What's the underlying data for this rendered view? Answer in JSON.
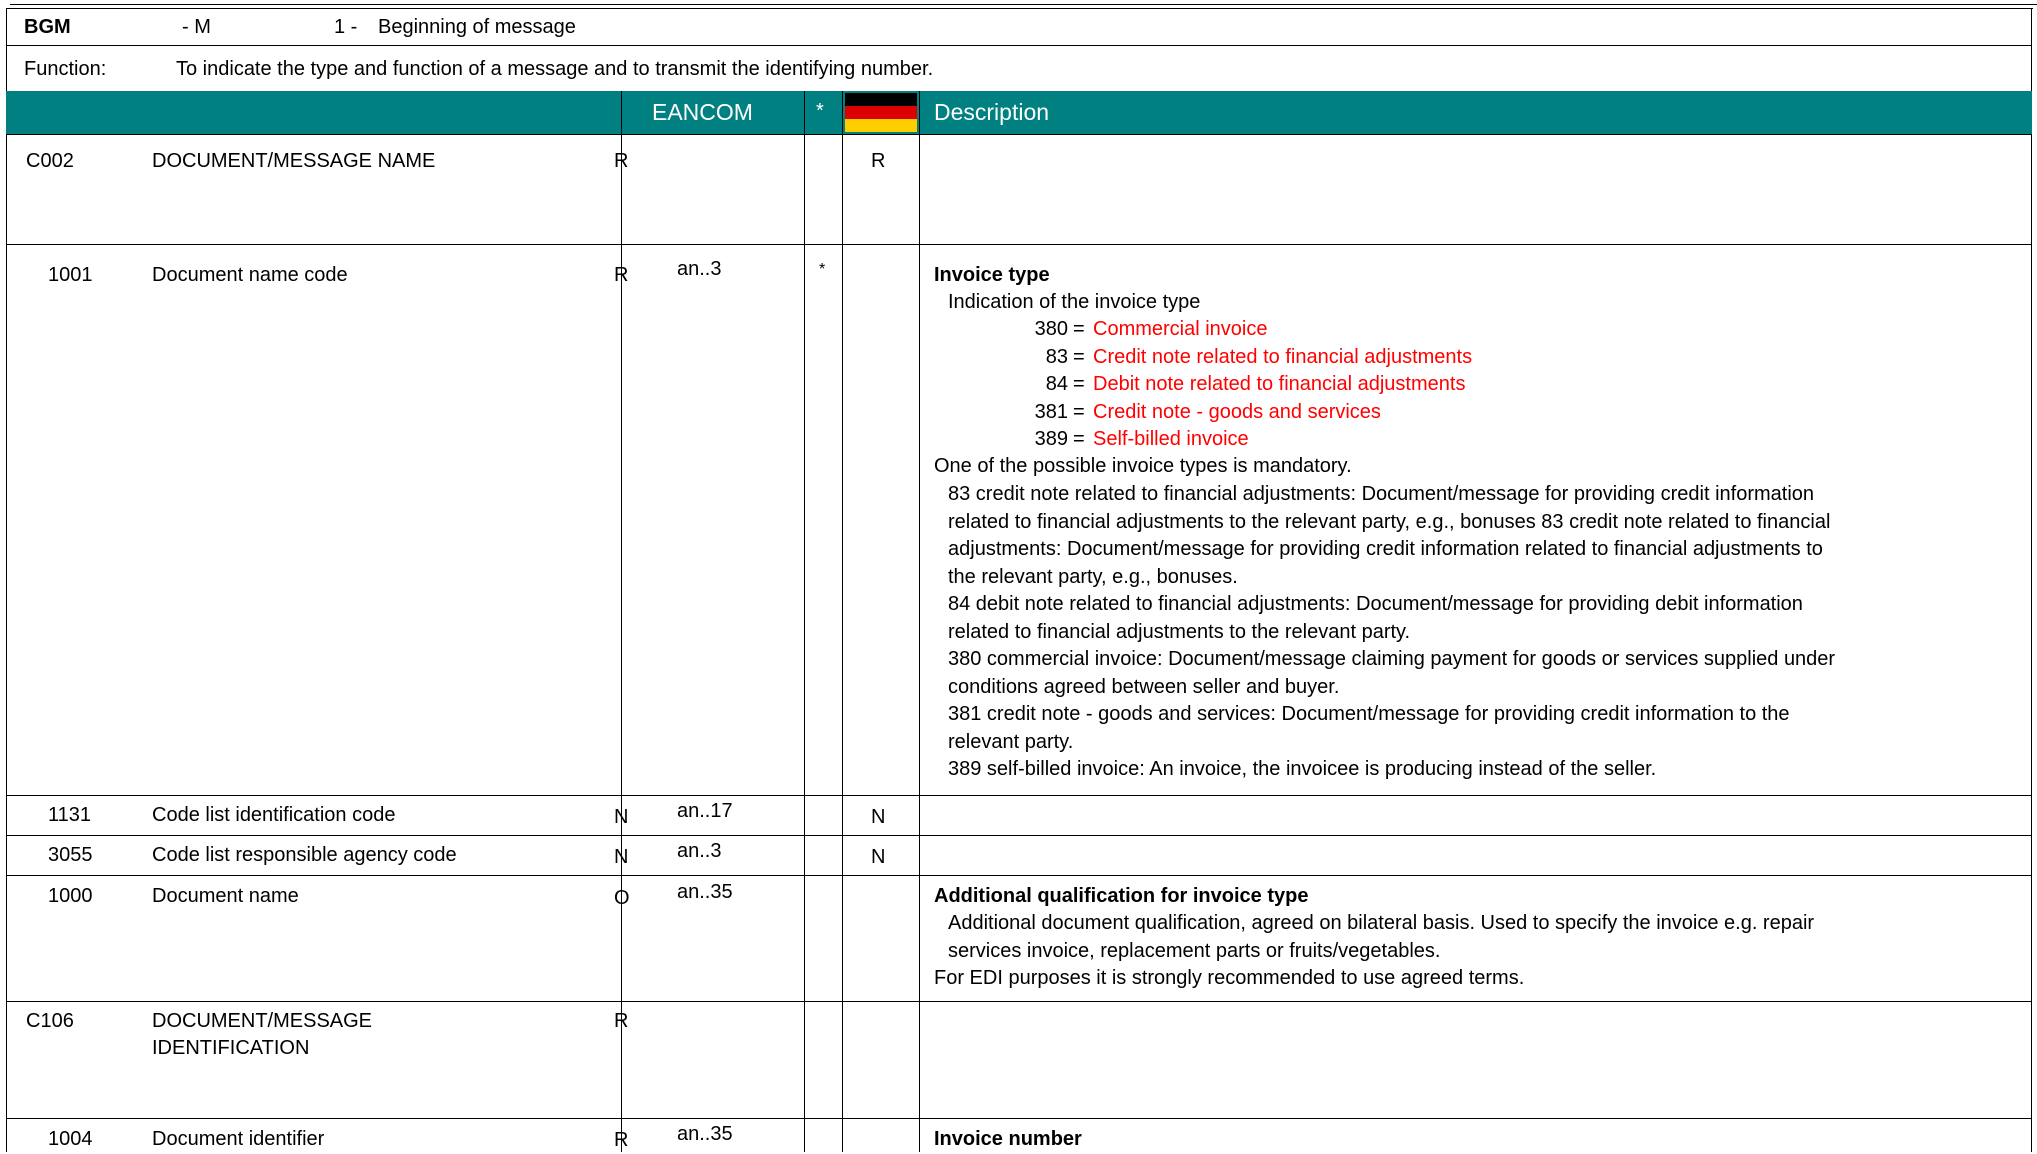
{
  "segment": {
    "tag": "BGM",
    "status": "- M",
    "repeat": "1 -",
    "name": "Beginning of message"
  },
  "function_row": {
    "label": "Function:",
    "text": "To indicate the type and function of a message and to transmit the identifying number."
  },
  "header": {
    "eancom": "EANCOM",
    "star": "*",
    "description": "Description",
    "flag_colors": [
      "#000000",
      "#dd0000",
      "#ffce00"
    ]
  },
  "rows": [
    {
      "code": "C002",
      "name": "DOCUMENT/MESSAGE NAME",
      "status": "R",
      "format": "",
      "star": "",
      "de": "R"
    },
    {
      "code": "1001",
      "name": "Document name code",
      "status": "R",
      "format": "an..3",
      "star": "*",
      "de": ""
    },
    {
      "code": "1131",
      "name": "Code list identification code",
      "status": "N",
      "format": "an..17",
      "star": "",
      "de": "N"
    },
    {
      "code": "3055",
      "name": "Code list responsible agency code",
      "status": "N",
      "format": "an..3",
      "star": "",
      "de": "N"
    },
    {
      "code": "1000",
      "name": "Document name",
      "status": "O",
      "format": "an..35",
      "star": "",
      "de": ""
    },
    {
      "code": "C106",
      "name": "DOCUMENT/MESSAGE",
      "name2": "IDENTIFICATION",
      "status": "R",
      "format": "",
      "star": "",
      "de": ""
    },
    {
      "code": "1004",
      "name": "Document identifier",
      "status": "R",
      "format": "an..35",
      "star": "",
      "de": ""
    }
  ],
  "desc_1001": {
    "title": "Invoice type",
    "subtitle": "Indication of the invoice type",
    "codes": [
      {
        "code": "380",
        "label": "Commercial invoice"
      },
      {
        "code": "83",
        "label": "Credit note related to financial adjustments"
      },
      {
        "code": "84",
        "label": "Debit note related to financial adjustments"
      },
      {
        "code": "381",
        "label": "Credit note - goods and services"
      },
      {
        "code": "389",
        "label": "Self-billed invoice"
      }
    ],
    "note": "One of the possible invoice types is mandatory.",
    "lines": [
      "83 credit note related to financial adjustments: Document/message for providing credit information",
      "related to financial adjustments to the relevant party, e.g., bonuses 83 credit note related to financial",
      "adjustments: Document/message for providing credit information related to financial adjustments to",
      "the relevant party, e.g., bonuses.",
      "84 debit note related to financial adjustments: Document/message for providing debit information",
      "related to financial adjustments to the relevant party.",
      "380 commercial invoice: Document/message claiming payment for goods or services supplied under",
      "conditions agreed between seller and buyer.",
      "381 credit note - goods and services: Document/message for providing credit information to the",
      "relevant party.",
      "389 self-billed invoice: An invoice, the invoicee is producing instead of the seller."
    ]
  },
  "desc_1000": {
    "title": "Additional qualification for invoice type",
    "lines": [
      "Additional document qualification, agreed on bilateral basis. Used to specify the invoice e.g. repair",
      "services invoice, replacement parts or fruits/vegetables."
    ],
    "note": "For EDI purposes it is strongly recommended to use agreed terms."
  },
  "desc_1004": {
    "title": "Invoice number"
  }
}
